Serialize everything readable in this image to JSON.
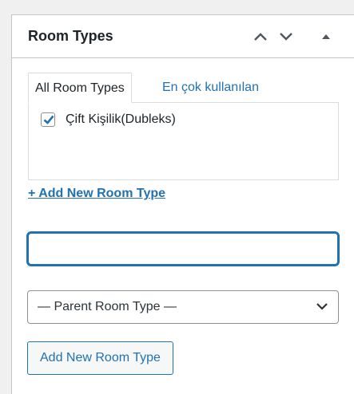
{
  "panel": {
    "title": "Room Types",
    "icons": [
      "chevron-up-icon",
      "chevron-down-icon",
      "triangle-up-icon"
    ]
  },
  "tabs": {
    "all_label": "All Room Types",
    "popular_label": "En çok kullanılan",
    "active": "all"
  },
  "room_types": [
    {
      "label": "Çift Kişilik(Dubleks)",
      "checked": true
    }
  ],
  "add_link_label": "+ Add New Room Type",
  "new_name_input": {
    "value": "",
    "placeholder": ""
  },
  "parent_select": {
    "selected": "— Parent Room Type —"
  },
  "submit_label": "Add New Room Type",
  "colors": {
    "accent": "#2271b1",
    "text": "#1d2327",
    "border": "#c3c4c7"
  }
}
